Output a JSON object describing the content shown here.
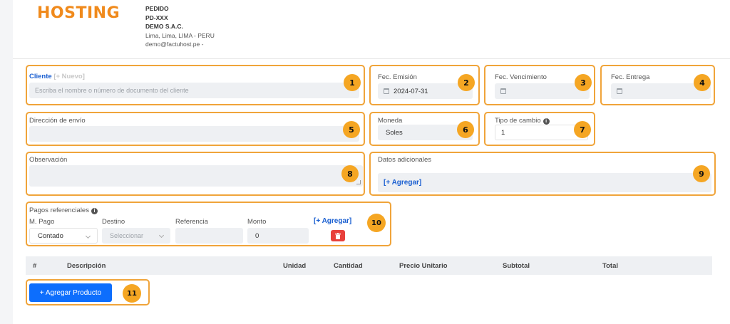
{
  "header": {
    "logo_text": "HOSTING",
    "doc_type": "PEDIDO",
    "doc_number": "PD-XXX",
    "company_name": "DEMO S.A.C.",
    "location": "Lima, Lima, LIMA - PERU",
    "email": "demo@factuhost.pe -"
  },
  "cliente": {
    "label": "Cliente",
    "new_link": "[+ Nuevo]",
    "placeholder": "Escriba el nombre o número de documento del cliente"
  },
  "fechas": {
    "emision_label": "Fec. Emisión",
    "emision_value": "2024-07-31",
    "vencimiento_label": "Fec. Vencimiento",
    "vencimiento_value": "",
    "entrega_label": "Fec. Entrega",
    "entrega_value": ""
  },
  "direccion": {
    "label": "Dirección de envío",
    "value": ""
  },
  "moneda": {
    "label": "Moneda",
    "value": "Soles"
  },
  "tipo_cambio": {
    "label": "Tipo de cambio",
    "value": "1"
  },
  "observacion": {
    "label": "Observación",
    "value": ""
  },
  "datos_adicionales": {
    "label": "Datos adicionales",
    "add_link": "[+ Agregar]"
  },
  "pagos": {
    "title": "Pagos referenciales",
    "col_mpago": "M. Pago",
    "col_destino": "Destino",
    "col_referencia": "Referencia",
    "col_monto": "Monto",
    "add_link": "[+ Agregar]",
    "row": {
      "mpago": "Contado",
      "destino": "Seleccionar",
      "referencia": "",
      "monto": "0"
    }
  },
  "table": {
    "headers": [
      "#",
      "Descripción",
      "Unidad",
      "Cantidad",
      "Precio Unitario",
      "Subtotal",
      "Total"
    ]
  },
  "add_product_button": "+ Agregar Producto",
  "badges": [
    "1",
    "2",
    "3",
    "4",
    "5",
    "6",
    "7",
    "8",
    "9",
    "10",
    "11"
  ],
  "colors": {
    "highlight": "#f0a43a",
    "badge": "#f5a623",
    "primary": "#0d6efd",
    "danger": "#e8403b",
    "link": "#1a5fd1",
    "brand": "#f08a1c"
  }
}
